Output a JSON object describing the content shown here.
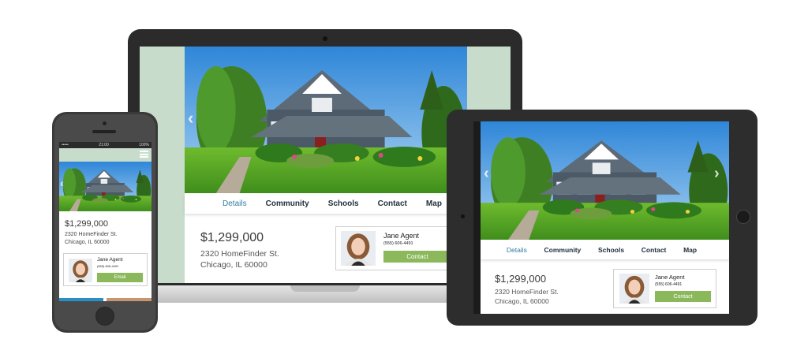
{
  "listing": {
    "price": "$1,299,000",
    "address_line1": "2320 HomeFinder St.",
    "address_line2": "Chicago, IL 60000"
  },
  "nav": {
    "items": [
      "Details",
      "Community",
      "Schools",
      "Contact",
      "Map"
    ]
  },
  "agent": {
    "name": "Jane Agent",
    "phone": "(555) 606-4491",
    "contact_label": "Contact",
    "email_label": "Email"
  },
  "phone_status": {
    "carrier": "•••••",
    "time": "21:00",
    "battery": "100%"
  },
  "icons": {
    "menu": "hamburger-menu-icon",
    "prev": "chevron-left-icon",
    "next": "chevron-right-icon"
  },
  "colors": {
    "accent_green": "#8ab85a",
    "header_green": "#c8dccb",
    "nav_active": "#2f7fa0",
    "nav_text": "#1f2d3a",
    "device_dark": "#2b2b2b"
  }
}
